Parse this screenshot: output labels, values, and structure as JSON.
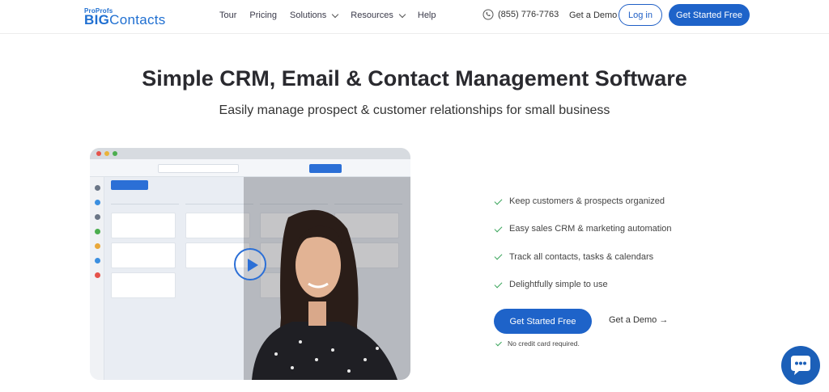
{
  "header": {
    "logo_small": "ProProfs",
    "logo_big_bold": "BIG",
    "logo_big_rest": "Contacts",
    "nav": [
      {
        "label": "Tour",
        "dropdown": false
      },
      {
        "label": "Pricing",
        "dropdown": false
      },
      {
        "label": "Solutions",
        "dropdown": true
      },
      {
        "label": "Resources",
        "dropdown": true
      },
      {
        "label": "Help",
        "dropdown": false
      }
    ],
    "phone": "(855) 776-7763",
    "demo_label": "Get a Demo",
    "login_label": "Log in",
    "cta_label": "Get Started Free"
  },
  "hero": {
    "title": "Simple CRM, Email & Contact Management Software",
    "subtitle": "Easily manage prospect & customer relationships for small business"
  },
  "features": [
    "Keep customers & prospects organized",
    "Easy sales CRM & marketing automation",
    "Track all contacts, tasks & calendars",
    "Delightfully simple to use"
  ],
  "actions": {
    "cta_label": "Get Started Free",
    "demo_label": "Get a Demo →",
    "note": "No credit card required."
  },
  "colors": {
    "brand": "#1e63c9",
    "check": "#3aa55b",
    "chat": "#1b5fb8"
  }
}
